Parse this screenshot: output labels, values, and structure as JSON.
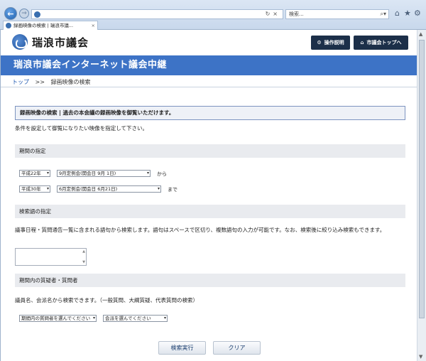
{
  "browser": {
    "search_placeholder": "検索...",
    "tab_title": "録画映像の検索 | 瑞浪市議..."
  },
  "header": {
    "site_name": "瑞浪市議会",
    "help_button": "操作説明",
    "top_button": "市議会トップへ"
  },
  "banner": {
    "title": "瑞浪市議会インターネット議会中継"
  },
  "breadcrumb": {
    "home": "トップ",
    "separator": ">>",
    "current": "録画映像の検索"
  },
  "intro": {
    "heading": "録画映像の検索 | 過去の本会議の録画映像を御覧いただけます。",
    "instruction": "条件を設定して御覧になりたい映像を指定して下さい。"
  },
  "period": {
    "section_title": "期間の指定",
    "from_era": "平成22年",
    "from_session": "9月定例会(開会日 9月 1日)",
    "from_label": "から",
    "to_era": "平成30年",
    "to_session": "6月定例会(開会日 6月21日)",
    "to_label": "まで"
  },
  "keyword": {
    "section_title": "検索語の指定",
    "description": "議事日程・質問通告一覧に含まれる語句から検索します。語句はスペースで区切り、複数語句の入力が可能です。なお、検索後に絞り込み検索もできます。",
    "value": ""
  },
  "speaker": {
    "section_title": "期間内の質疑者・質問者",
    "description": "議員名、会派名から検索できます。（一般質問、大綱質疑、代表質問の検索）",
    "member_select": "期間内の質問者を選んでください",
    "faction_select": "会派を選んでください"
  },
  "actions": {
    "search": "検索実行",
    "clear": "クリア"
  }
}
